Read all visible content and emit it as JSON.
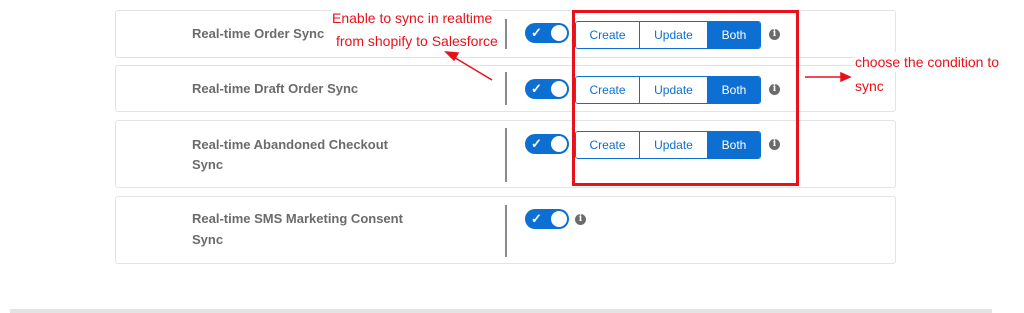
{
  "rows": [
    {
      "label": "Real-time Order Sync",
      "options": [
        "Create",
        "Update",
        "Both"
      ],
      "selected": "Both",
      "enabled": true
    },
    {
      "label": "Real-time Draft Order Sync",
      "options": [
        "Create",
        "Update",
        "Both"
      ],
      "selected": "Both",
      "enabled": true
    },
    {
      "label": "Real-time Abandoned Checkout Sync",
      "label_line1": "Real-time Abandoned Checkout",
      "label_line2": "Sync",
      "options": [
        "Create",
        "Update",
        "Both"
      ],
      "selected": "Both",
      "enabled": true
    },
    {
      "label": "Real-time SMS Marketing Consent Sync",
      "label_line1": "Real-time SMS Marketing Consent",
      "label_line2": "Sync",
      "enabled": true
    }
  ],
  "toggle_glyph": "✓",
  "info_glyph": "i",
  "annotations": {
    "left_line1": "Enable to sync in realtime",
    "left_line2": "from shopify to Salesforce",
    "right_line1": "choose the condition to",
    "right_line2": "sync"
  },
  "colors": {
    "accent": "#0c6fd1",
    "annotation": "#e8111a",
    "label": "#6b6b6b"
  }
}
